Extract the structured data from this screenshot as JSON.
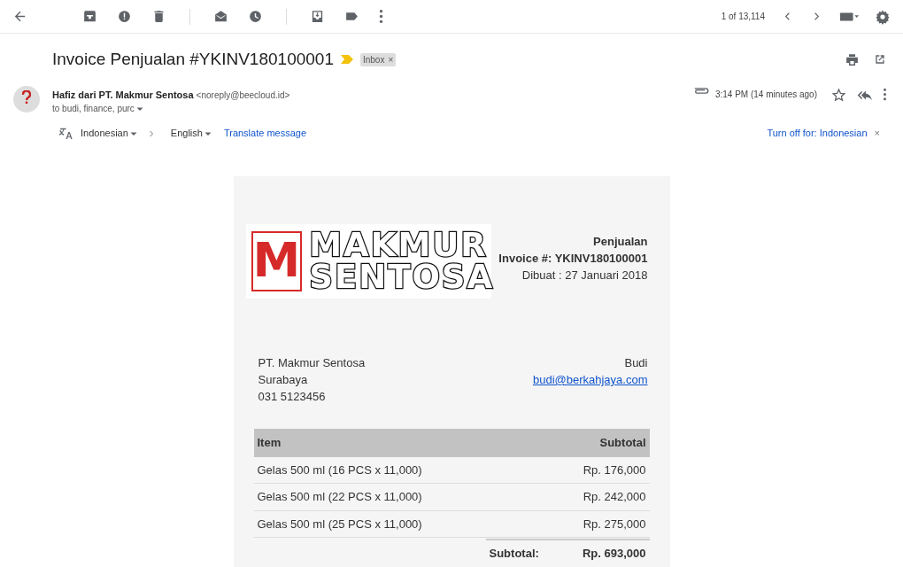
{
  "toolbar": {
    "pagination": "1 of 13,114"
  },
  "subject": {
    "title": "Invoice Penjualan #YKINV180100001",
    "important": true,
    "labels": [
      {
        "text": "Inbox",
        "remove": "×"
      }
    ]
  },
  "message": {
    "sender_name": "Hafiz dari PT. Makmur Sentosa",
    "sender_email": "<noreply@beecloud.id>",
    "recipients": "to budi, finance, purc",
    "has_attachment": true,
    "time": "3:14 PM (14 minutes ago)",
    "starred": false
  },
  "translate": {
    "from": "Indonesian",
    "to": "English",
    "link": "Translate message",
    "turn_off": "Turn off for: Indonesian",
    "close": "×"
  },
  "invoice": {
    "logo": {
      "mark": "M",
      "line1": "MAKMUR",
      "line2": "SENTOSA"
    },
    "header": [
      "Penjualan",
      "Invoice #: YKINV180100001",
      "Dibuat : 27 Januari 2018"
    ],
    "seller": [
      "PT. Makmur Sentosa",
      "Surabaya",
      "031 5123456"
    ],
    "buyer": {
      "name": "Budi",
      "email": "budi@berkahjaya.com"
    },
    "columns": [
      "Item",
      "Subtotal"
    ],
    "rows": [
      [
        "Gelas 500 ml (16 PCS x 11,000)",
        "Rp. 176,000"
      ],
      [
        "Gelas 500 ml (22 PCS x 11,000)",
        "Rp. 242,000"
      ],
      [
        "Gelas 500 ml (25 PCS x 11,000)",
        "Rp. 275,000"
      ]
    ],
    "subtotal": {
      "label": "Subtotal:",
      "value": "Rp. 693,000"
    }
  }
}
